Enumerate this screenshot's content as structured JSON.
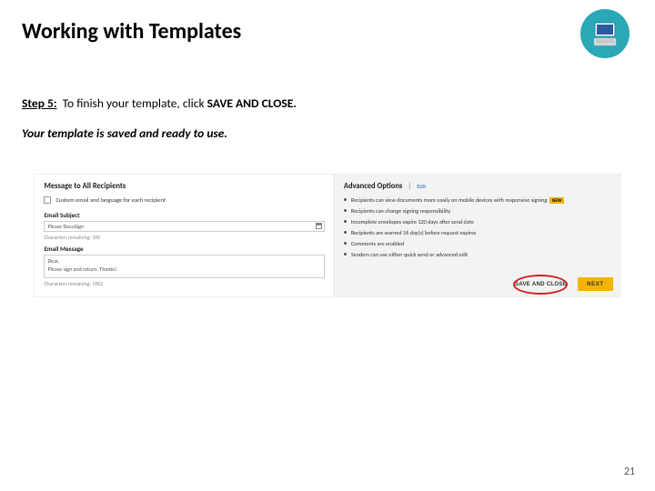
{
  "title": "Working with Templates",
  "step": {
    "prefix": "Step 5:",
    "text_before": "To finish your template, click ",
    "action": "SAVE AND CLOSE."
  },
  "confirm": "Your template is saved and ready to use.",
  "page_number": "21",
  "app": {
    "left": {
      "heading": "Message to All Recipients",
      "custom_label": "Custom email and language for each recipient",
      "subject_label": "Email Subject",
      "subject_value": "Please DocuSign",
      "remaining": "Characters remaining: 100",
      "message_label": "Email Message",
      "message_greeting": "Dear,",
      "message_body": "Please sign and return. Thanks!",
      "remaining2": "Characters remaining: 1962"
    },
    "right": {
      "heading": "Advanced Options",
      "edit": "Edit",
      "bullets": [
        {
          "text": "Recipients can view documents more easily on mobile devices with responsive signing",
          "badge": "NEW"
        },
        {
          "text": "Recipients can change signing responsibility"
        },
        {
          "text": "Incomplete envelopes expire 120 days after send date"
        },
        {
          "text": "Recipients are warned 16 day(s) before request expires"
        },
        {
          "text": "Comments are enabled"
        },
        {
          "text": "Senders can use either quick send or advanced edit"
        }
      ]
    },
    "buttons": {
      "save_close": "SAVE AND CLOSE",
      "next": "NEXT"
    }
  }
}
